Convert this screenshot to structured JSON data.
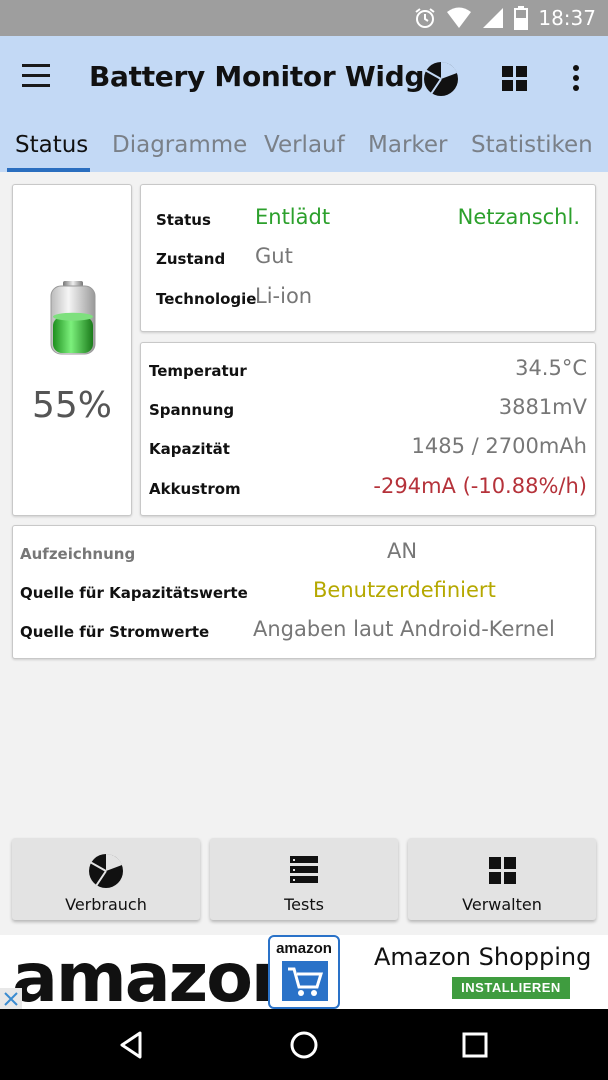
{
  "status_bar": {
    "time": "18:37",
    "icons": [
      "alarm-icon",
      "wifi-icon",
      "signal-icon",
      "battery-icon"
    ]
  },
  "app_bar": {
    "title": "Battery Monitor Widget",
    "actions": [
      "pie-chart-icon",
      "grid-icon",
      "more-vert-icon"
    ]
  },
  "tabs": [
    {
      "label": "Status",
      "active": true
    },
    {
      "label": "Diagramme"
    },
    {
      "label": "Verlauf"
    },
    {
      "label": "Marker"
    },
    {
      "label": "Statistiken"
    }
  ],
  "battery": {
    "percent": "55%",
    "level": 0.55,
    "color": "#33cc33"
  },
  "status_card": {
    "status_label": "Status",
    "status_value": "Entlädt",
    "power_value": "Netzanschl.",
    "health_label": "Zustand",
    "health_value": "Gut",
    "tech_label": "Technologie",
    "tech_value": "Li-ion"
  },
  "measure_card": {
    "temp_label": "Temperatur",
    "temp_value": "34.5°C",
    "voltage_label": "Spannung",
    "voltage_value": "3881mV",
    "capacity_label": "Kapazität",
    "capacity_value": "1485 / 2700mAh",
    "current_label": "Akkustrom",
    "current_value": "-294mA (-10.88%/h)"
  },
  "recording_card": {
    "recording_label": "Aufzeichnung",
    "recording_value": "AN",
    "cap_source_label": "Quelle für Kapazitätswerte",
    "cap_source_value": "Benutzerdefiniert",
    "current_source_label": "Quelle für Stromwerte",
    "current_source_value": "Angaben laut Android-Kernel"
  },
  "bottom_buttons": [
    {
      "label": "Verbrauch",
      "icon": "pie-chart-icon"
    },
    {
      "label": "Tests",
      "icon": "list-icon"
    },
    {
      "label": "Verwalten",
      "icon": "grid-icon"
    }
  ],
  "ad": {
    "wordmark": "amazon",
    "logo_text": "amazon",
    "title": "Amazon Shopping",
    "install_label": "INSTALLIEREN"
  },
  "colors": {
    "app_bar": "#c3d9f5",
    "tab_indicator": "#2a6ebf",
    "positive": "#2ca02c",
    "negative": "#b5323a",
    "custom": "#b5a800"
  }
}
